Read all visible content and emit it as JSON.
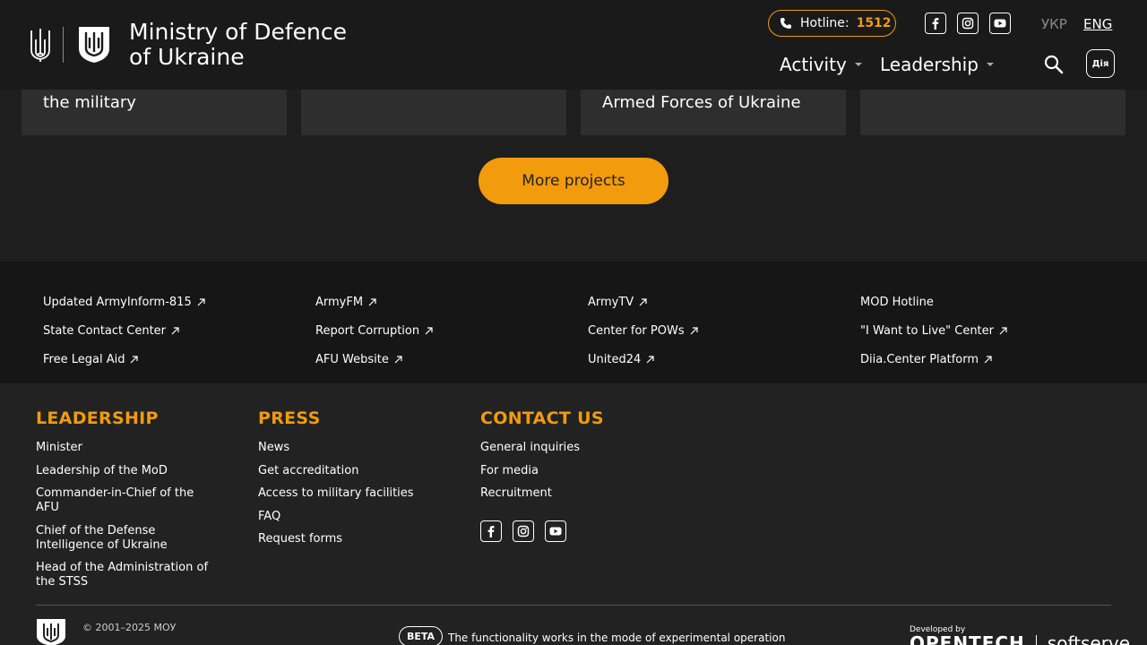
{
  "header": {
    "logo_line1": "Ministry of Defence",
    "logo_line2": "of Ukraine",
    "hotline_label": "Hotline:",
    "hotline_number": "1512",
    "lang_ukr": "УКР",
    "lang_eng": "ENG",
    "nav_activity": "Activity",
    "nav_leadership": "Leadership",
    "diia_label": "Дія",
    "accent_color": "#f29b0c"
  },
  "cards": [
    {
      "partial": "the military"
    },
    {
      "partial": ""
    },
    {
      "partial": "Armed Forces of Ukraine"
    },
    {
      "partial": ""
    }
  ],
  "more_projects_label": "More projects",
  "links": {
    "col1": [
      "Updated ArmyInform-815",
      "State Contact Center",
      "Free Legal Aid"
    ],
    "col2": [
      "ArmyFM",
      "Report Corruption",
      "AFU Website"
    ],
    "col3": [
      "ArmyTV",
      "Center for POWs",
      "United24"
    ],
    "col4": [
      "MOD Hotline",
      "\"I Want to Live\" Center",
      "Diia.Center Platform"
    ]
  },
  "footer": {
    "leadership": {
      "title": "LEADERSHIP",
      "items": [
        "Minister",
        "Leadership of the MoD",
        "Commander-in-Chief of the AFU",
        "Chief of the Defense Intelligence of Ukraine",
        "Head of the Administration of the STSS"
      ]
    },
    "press": {
      "title": "PRESS",
      "items": [
        "News",
        "Get accreditation",
        "Access to military facilities",
        "FAQ",
        "Request forms"
      ]
    },
    "contact": {
      "title": "CONTACT US",
      "items": [
        "General inquiries",
        "For media",
        "Recruitment"
      ]
    },
    "copyright": "© 2001–2025 МОУ",
    "beta_badge": "BETA",
    "beta_text": "The functionality works in the mode of experimental operation",
    "developed_by": "Developed by",
    "dev1": "OPENTECH",
    "dev2": "softserve"
  }
}
